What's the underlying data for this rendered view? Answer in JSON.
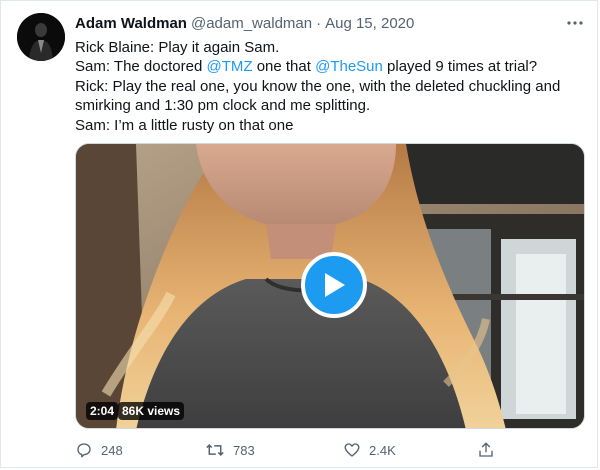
{
  "tweet": {
    "author_name": "Adam Waldman",
    "handle": "@adam_waldman",
    "separator": "·",
    "date": "Aug 15, 2020",
    "more_icon": "more-horizontal-icon",
    "lines": {
      "l1": "Rick Blaine: Play it again Sam.",
      "l2_a": "Sam: The doctored ",
      "l2_m1": "@TMZ",
      "l2_b": " one that ",
      "l2_m2": "@TheSun",
      "l2_c": " played 9 times at trial?",
      "l3": "Rick: Play the real one, you know the one, with the deleted chuckling and smirking and 1:30 pm clock and me splitting.",
      "l4": "Sam: I’m a little rusty on that one"
    },
    "mention_color": "#1d9bf0",
    "video": {
      "duration": "2:04",
      "views": "86K views",
      "play_icon": "play-icon",
      "accent": "#1d9bf0"
    },
    "actions": {
      "reply_count": "248",
      "retweet_count": "783",
      "like_count": "2.4K",
      "share_icon": "share-icon"
    }
  }
}
